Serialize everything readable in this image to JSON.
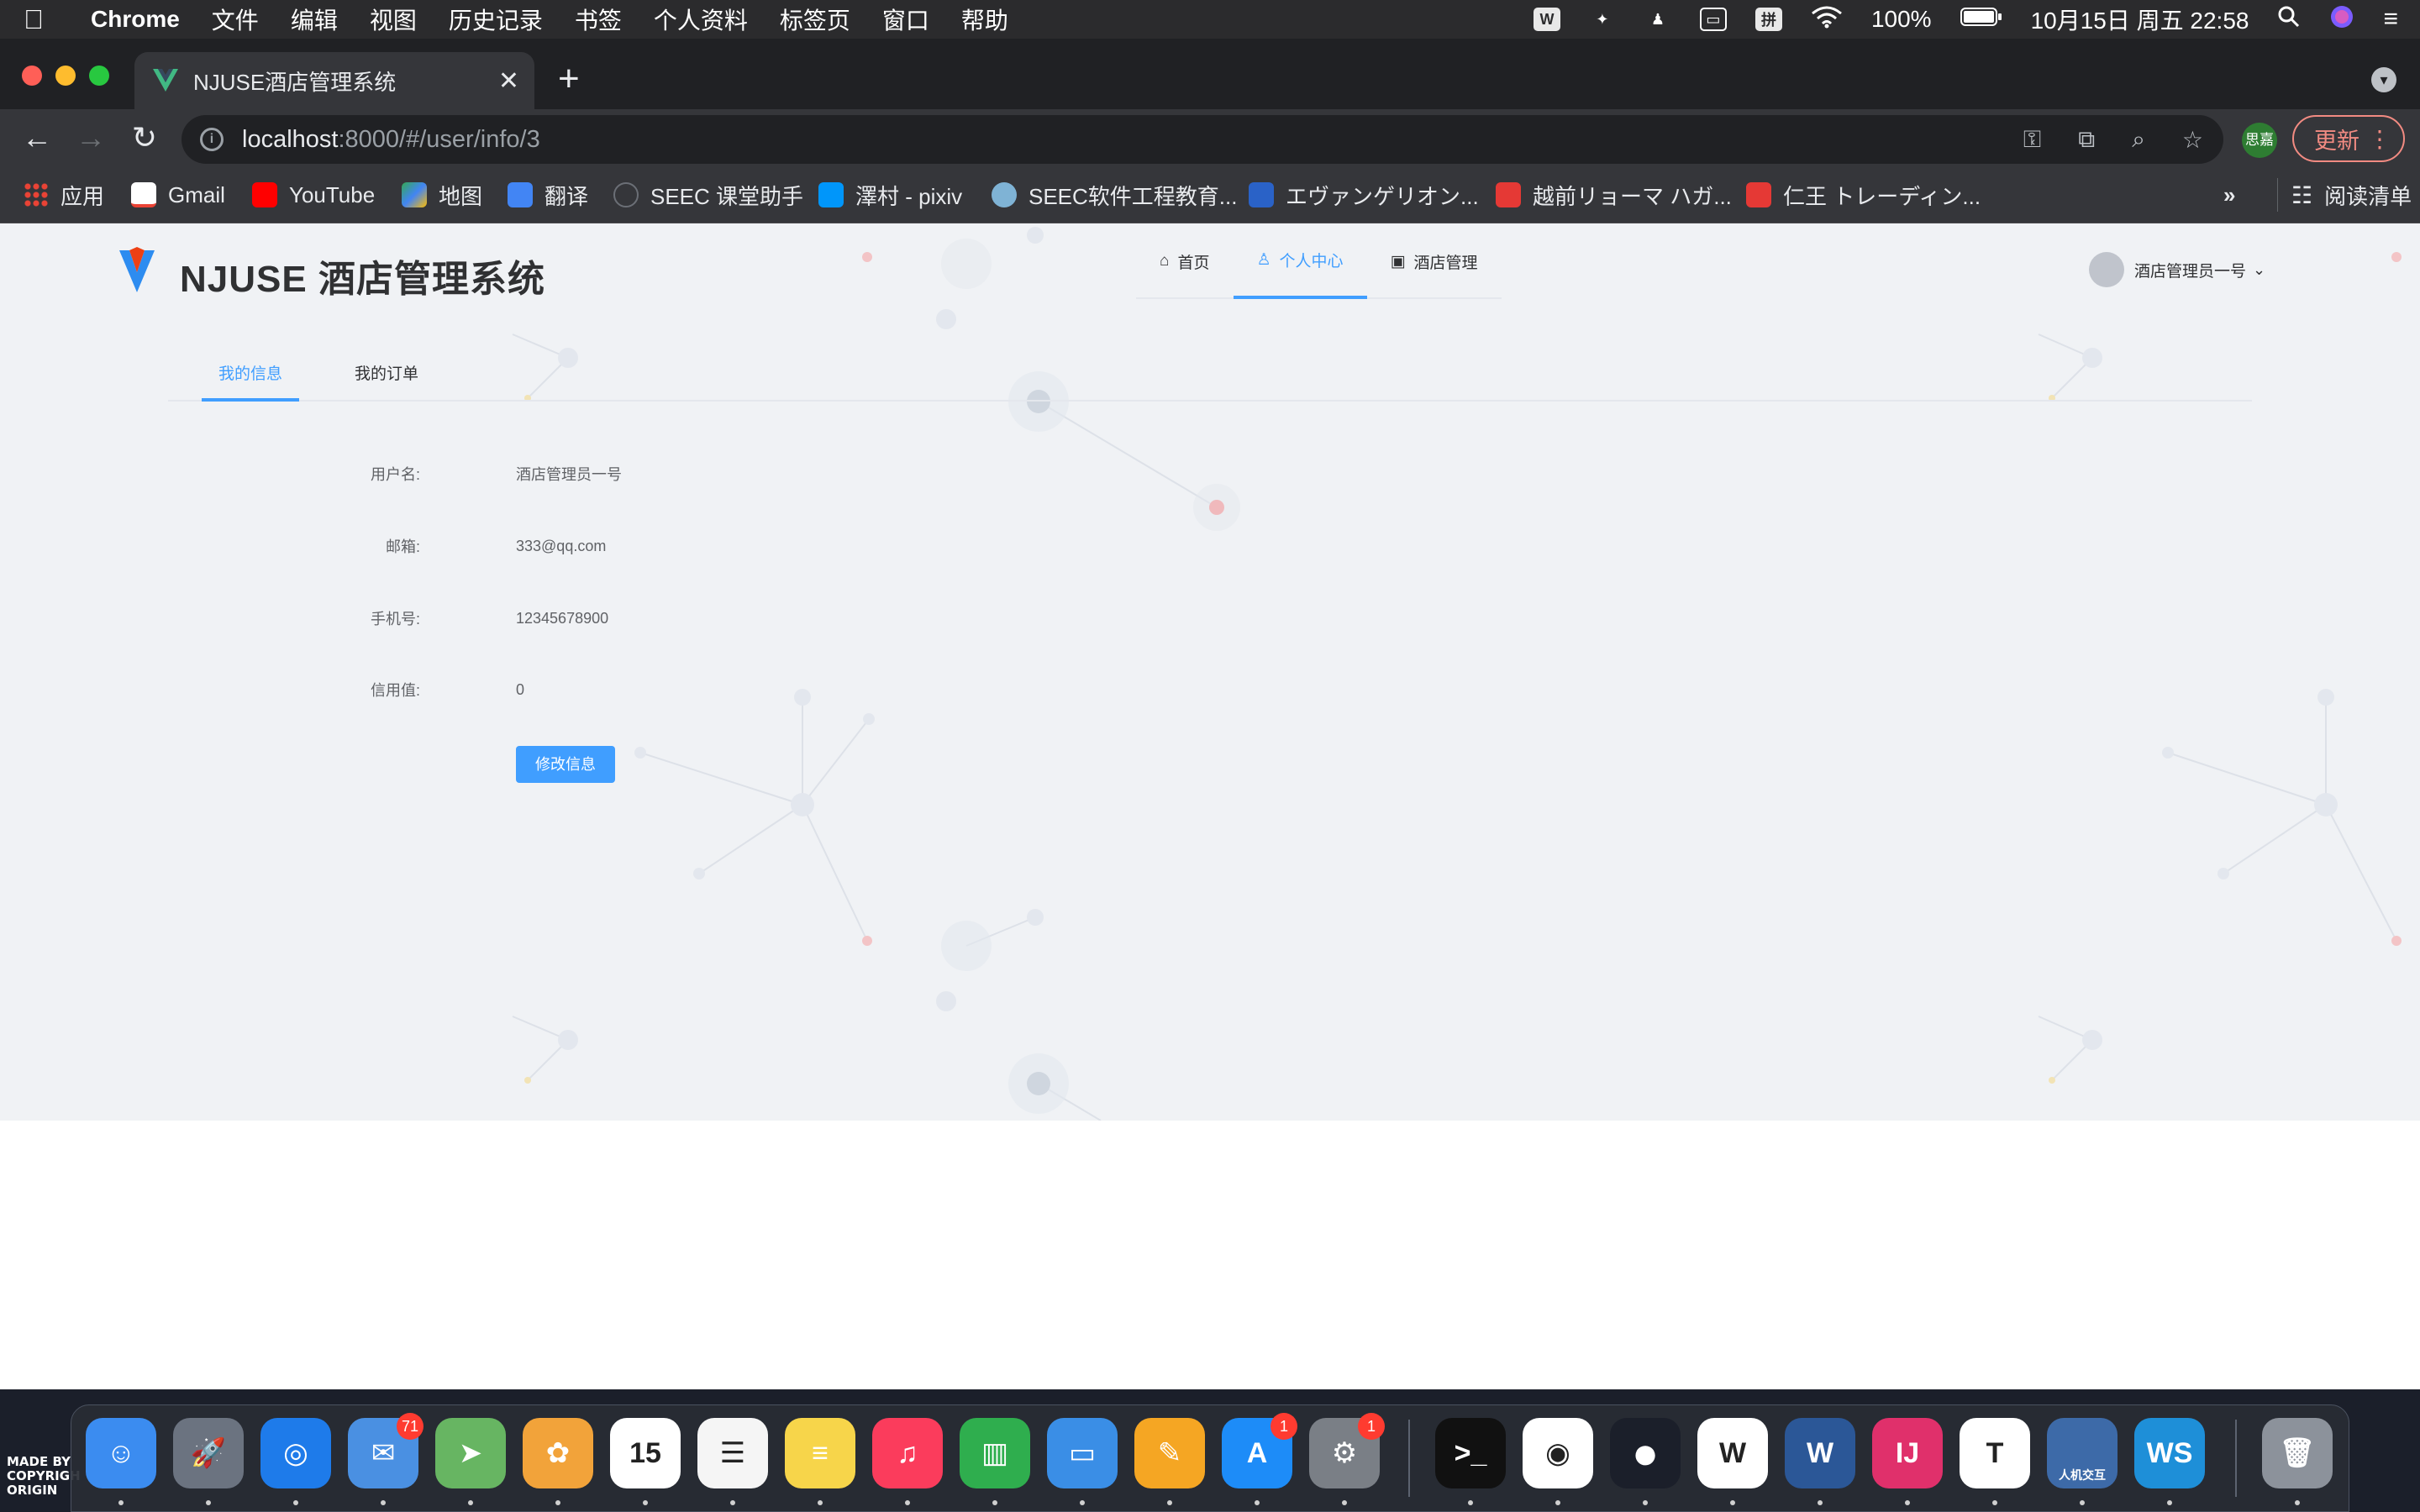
{
  "menubar": {
    "app_name": "Chrome",
    "items": [
      "文件",
      "编辑",
      "视图",
      "历史记录",
      "书签",
      "个人资料",
      "标签页",
      "窗口",
      "帮助"
    ],
    "battery": "100%",
    "datetime": "10月15日 周五  22:58"
  },
  "browser": {
    "tab_title": "NJUSE酒店管理系统",
    "url_host": "localhost",
    "url_path": ":8000/#/user/info/3",
    "profile_initials": "思嘉",
    "update_label": "更新",
    "bookmarks": [
      {
        "label": "应用",
        "color": "#4285f4"
      },
      {
        "label": "Gmail",
        "color": "#ea4335"
      },
      {
        "label": "YouTube",
        "color": "#ff0000"
      },
      {
        "label": "地图",
        "color": "#34a853"
      },
      {
        "label": "翻译",
        "color": "#4285f4"
      },
      {
        "label": "SEEC 课堂助手",
        "color": "#6b6f76"
      },
      {
        "label": "澤村 - pixiv",
        "color": "#0096fa"
      },
      {
        "label": "SEEC软件工程教育...",
        "color": "#7fb3d5"
      },
      {
        "label": "エヴァンゲリオン...",
        "color": "#2a62c7"
      },
      {
        "label": "越前リョーマ ハガ...",
        "color": "#e53935"
      },
      {
        "label": "仁王 トレーディン...",
        "color": "#e53935"
      }
    ],
    "reading_list": "阅读清单"
  },
  "app": {
    "title": "NJUSE 酒店管理系统",
    "nav": [
      {
        "label": "首页",
        "icon": "home-icon"
      },
      {
        "label": "个人中心",
        "icon": "user-icon"
      },
      {
        "label": "酒店管理",
        "icon": "hotel-icon"
      }
    ],
    "user_name": "酒店管理员一号",
    "subtabs": [
      "我的信息",
      "我的订单"
    ],
    "fields": [
      {
        "label": "用户名:",
        "value": "酒店管理员一号"
      },
      {
        "label": "邮箱:",
        "value": "333@qq.com"
      },
      {
        "label": "手机号:",
        "value": "12345678900"
      },
      {
        "label": "信用值:",
        "value": "0"
      }
    ],
    "edit_button": "修改信息",
    "accent": "#409eff"
  },
  "dock": {
    "items": [
      {
        "name": "finder",
        "glyph": "☺",
        "color": "#3b8cf0"
      },
      {
        "name": "launchpad",
        "glyph": "🚀",
        "color": "#6b7380"
      },
      {
        "name": "safari",
        "glyph": "◎",
        "color": "#1e7bea"
      },
      {
        "name": "mail",
        "glyph": "✉",
        "color": "#4a90e2",
        "badge": "71"
      },
      {
        "name": "maps",
        "glyph": "➤",
        "color": "#67b562"
      },
      {
        "name": "photos",
        "glyph": "✿",
        "color": "#f2a33a"
      },
      {
        "name": "calendar",
        "glyph": "15",
        "color": "#ffffff"
      },
      {
        "name": "reminders",
        "glyph": "☰",
        "color": "#f5f5f5"
      },
      {
        "name": "notes",
        "glyph": "≡",
        "color": "#f7d54a"
      },
      {
        "name": "music",
        "glyph": "♫",
        "color": "#fb3c5c"
      },
      {
        "name": "numbers",
        "glyph": "▥",
        "color": "#2fae4e"
      },
      {
        "name": "keynote",
        "glyph": "▭",
        "color": "#3a8ee6"
      },
      {
        "name": "pages",
        "glyph": "✎",
        "color": "#f5a623"
      },
      {
        "name": "app-store",
        "glyph": "A",
        "color": "#1d8cf8",
        "badge": "1"
      },
      {
        "name": "system-preferences",
        "glyph": "⚙",
        "color": "#7a7f86",
        "badge": "1"
      },
      {
        "name": "terminal",
        "glyph": ">_",
        "color": "#111111"
      },
      {
        "name": "chrome",
        "glyph": "◉",
        "color": "#ffffff"
      },
      {
        "name": "qq",
        "glyph": "●",
        "color": "#1b1f2a"
      },
      {
        "name": "wps",
        "glyph": "W",
        "color": "#ffffff"
      },
      {
        "name": "word",
        "glyph": "W",
        "color": "#2b5797"
      },
      {
        "name": "intellij",
        "glyph": "IJ",
        "color": "#e0306b"
      },
      {
        "name": "typora",
        "glyph": "T",
        "color": "#ffffff"
      },
      {
        "name": "human-computer",
        "glyph": "人机交互",
        "color": "#3d6aa8"
      },
      {
        "name": "webstorm",
        "glyph": "WS",
        "color": "#1e8fd8"
      },
      {
        "name": "trash",
        "glyph": "🗑",
        "color": "#8c929b"
      }
    ]
  },
  "watermark": "MADE BY\nCOPYRIGH\nORIGIN"
}
